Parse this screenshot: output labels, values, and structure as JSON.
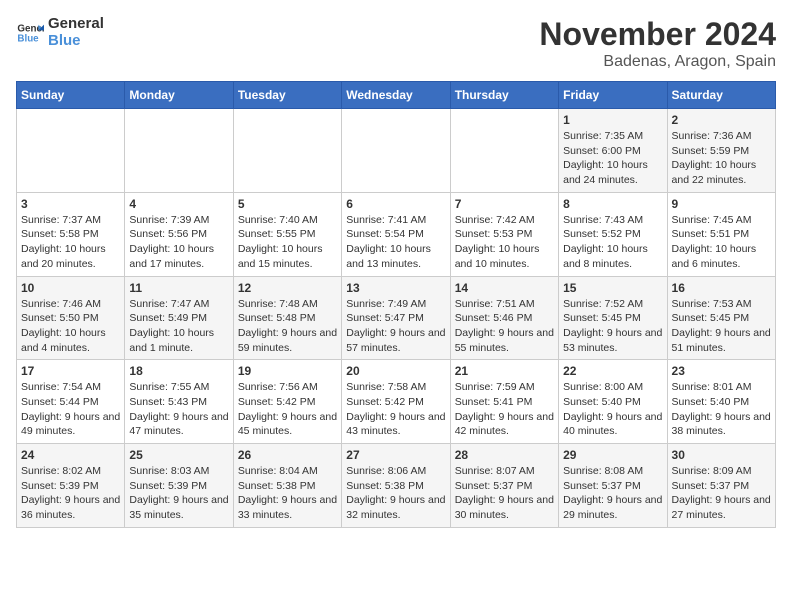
{
  "logo": {
    "line1": "General",
    "line2": "Blue"
  },
  "title": "November 2024",
  "location": "Badenas, Aragon, Spain",
  "weekdays": [
    "Sunday",
    "Monday",
    "Tuesday",
    "Wednesday",
    "Thursday",
    "Friday",
    "Saturday"
  ],
  "weeks": [
    [
      {
        "day": "",
        "info": ""
      },
      {
        "day": "",
        "info": ""
      },
      {
        "day": "",
        "info": ""
      },
      {
        "day": "",
        "info": ""
      },
      {
        "day": "",
        "info": ""
      },
      {
        "day": "1",
        "info": "Sunrise: 7:35 AM\nSunset: 6:00 PM\nDaylight: 10 hours and 24 minutes."
      },
      {
        "day": "2",
        "info": "Sunrise: 7:36 AM\nSunset: 5:59 PM\nDaylight: 10 hours and 22 minutes."
      }
    ],
    [
      {
        "day": "3",
        "info": "Sunrise: 7:37 AM\nSunset: 5:58 PM\nDaylight: 10 hours and 20 minutes."
      },
      {
        "day": "4",
        "info": "Sunrise: 7:39 AM\nSunset: 5:56 PM\nDaylight: 10 hours and 17 minutes."
      },
      {
        "day": "5",
        "info": "Sunrise: 7:40 AM\nSunset: 5:55 PM\nDaylight: 10 hours and 15 minutes."
      },
      {
        "day": "6",
        "info": "Sunrise: 7:41 AM\nSunset: 5:54 PM\nDaylight: 10 hours and 13 minutes."
      },
      {
        "day": "7",
        "info": "Sunrise: 7:42 AM\nSunset: 5:53 PM\nDaylight: 10 hours and 10 minutes."
      },
      {
        "day": "8",
        "info": "Sunrise: 7:43 AM\nSunset: 5:52 PM\nDaylight: 10 hours and 8 minutes."
      },
      {
        "day": "9",
        "info": "Sunrise: 7:45 AM\nSunset: 5:51 PM\nDaylight: 10 hours and 6 minutes."
      }
    ],
    [
      {
        "day": "10",
        "info": "Sunrise: 7:46 AM\nSunset: 5:50 PM\nDaylight: 10 hours and 4 minutes."
      },
      {
        "day": "11",
        "info": "Sunrise: 7:47 AM\nSunset: 5:49 PM\nDaylight: 10 hours and 1 minute."
      },
      {
        "day": "12",
        "info": "Sunrise: 7:48 AM\nSunset: 5:48 PM\nDaylight: 9 hours and 59 minutes."
      },
      {
        "day": "13",
        "info": "Sunrise: 7:49 AM\nSunset: 5:47 PM\nDaylight: 9 hours and 57 minutes."
      },
      {
        "day": "14",
        "info": "Sunrise: 7:51 AM\nSunset: 5:46 PM\nDaylight: 9 hours and 55 minutes."
      },
      {
        "day": "15",
        "info": "Sunrise: 7:52 AM\nSunset: 5:45 PM\nDaylight: 9 hours and 53 minutes."
      },
      {
        "day": "16",
        "info": "Sunrise: 7:53 AM\nSunset: 5:45 PM\nDaylight: 9 hours and 51 minutes."
      }
    ],
    [
      {
        "day": "17",
        "info": "Sunrise: 7:54 AM\nSunset: 5:44 PM\nDaylight: 9 hours and 49 minutes."
      },
      {
        "day": "18",
        "info": "Sunrise: 7:55 AM\nSunset: 5:43 PM\nDaylight: 9 hours and 47 minutes."
      },
      {
        "day": "19",
        "info": "Sunrise: 7:56 AM\nSunset: 5:42 PM\nDaylight: 9 hours and 45 minutes."
      },
      {
        "day": "20",
        "info": "Sunrise: 7:58 AM\nSunset: 5:42 PM\nDaylight: 9 hours and 43 minutes."
      },
      {
        "day": "21",
        "info": "Sunrise: 7:59 AM\nSunset: 5:41 PM\nDaylight: 9 hours and 42 minutes."
      },
      {
        "day": "22",
        "info": "Sunrise: 8:00 AM\nSunset: 5:40 PM\nDaylight: 9 hours and 40 minutes."
      },
      {
        "day": "23",
        "info": "Sunrise: 8:01 AM\nSunset: 5:40 PM\nDaylight: 9 hours and 38 minutes."
      }
    ],
    [
      {
        "day": "24",
        "info": "Sunrise: 8:02 AM\nSunset: 5:39 PM\nDaylight: 9 hours and 36 minutes."
      },
      {
        "day": "25",
        "info": "Sunrise: 8:03 AM\nSunset: 5:39 PM\nDaylight: 9 hours and 35 minutes."
      },
      {
        "day": "26",
        "info": "Sunrise: 8:04 AM\nSunset: 5:38 PM\nDaylight: 9 hours and 33 minutes."
      },
      {
        "day": "27",
        "info": "Sunrise: 8:06 AM\nSunset: 5:38 PM\nDaylight: 9 hours and 32 minutes."
      },
      {
        "day": "28",
        "info": "Sunrise: 8:07 AM\nSunset: 5:37 PM\nDaylight: 9 hours and 30 minutes."
      },
      {
        "day": "29",
        "info": "Sunrise: 8:08 AM\nSunset: 5:37 PM\nDaylight: 9 hours and 29 minutes."
      },
      {
        "day": "30",
        "info": "Sunrise: 8:09 AM\nSunset: 5:37 PM\nDaylight: 9 hours and 27 minutes."
      }
    ]
  ]
}
